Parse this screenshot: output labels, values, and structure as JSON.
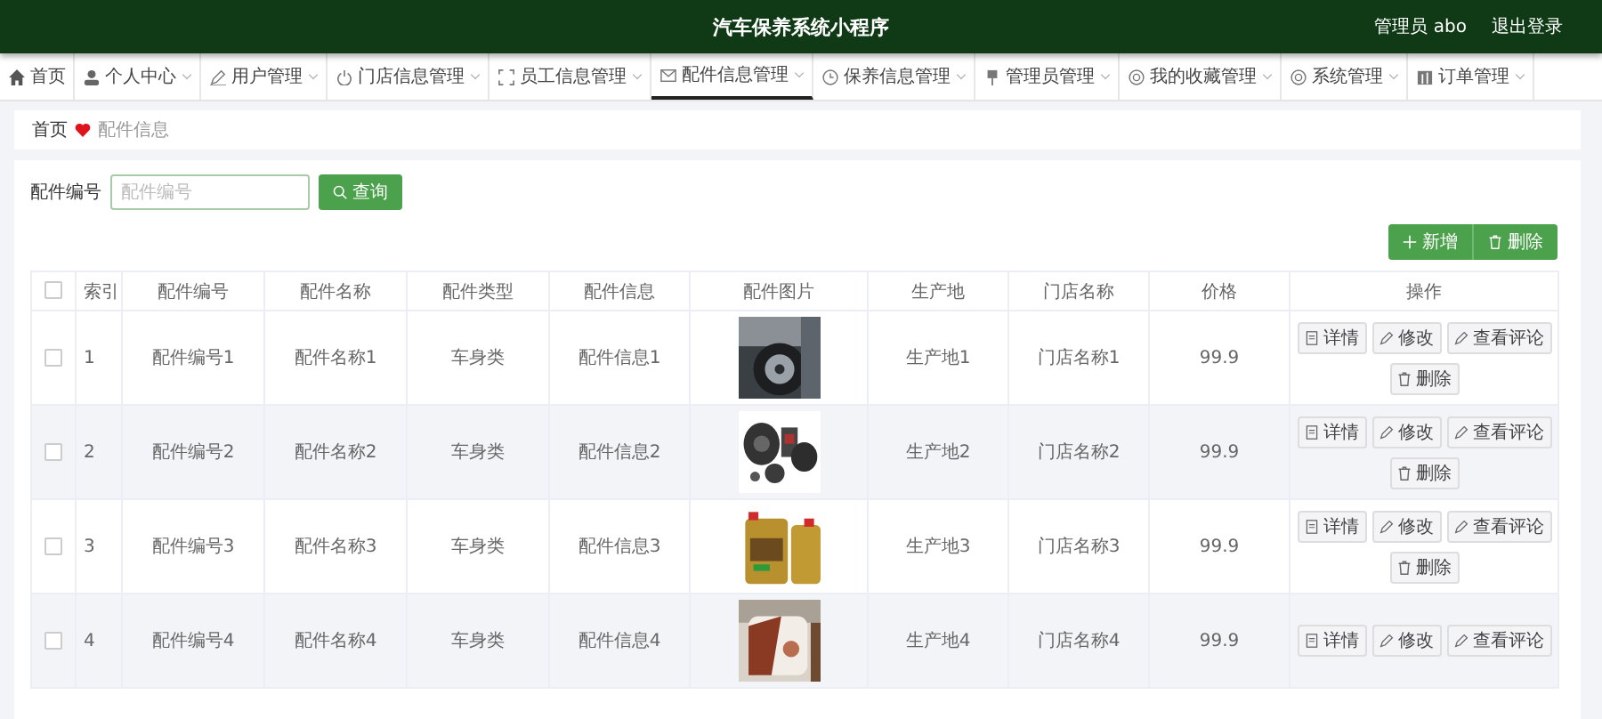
{
  "header": {
    "title": "汽车保养系统小程序",
    "user": "管理员 abo",
    "logout": "退出登录"
  },
  "nav": [
    {
      "label": "首页",
      "dropdown": false,
      "selected": false
    },
    {
      "label": "个人中心",
      "dropdown": true,
      "selected": false
    },
    {
      "label": "用户管理",
      "dropdown": true,
      "selected": false
    },
    {
      "label": "门店信息管理",
      "dropdown": true,
      "selected": false
    },
    {
      "label": "员工信息管理",
      "dropdown": true,
      "selected": false
    },
    {
      "label": "配件信息管理",
      "dropdown": true,
      "selected": true
    },
    {
      "label": "保养信息管理",
      "dropdown": true,
      "selected": false
    },
    {
      "label": "管理员管理",
      "dropdown": true,
      "selected": false
    },
    {
      "label": "我的收藏管理",
      "dropdown": true,
      "selected": false
    },
    {
      "label": "系统管理",
      "dropdown": true,
      "selected": false
    },
    {
      "label": "订单管理",
      "dropdown": true,
      "selected": false
    }
  ],
  "breadcrumb": [
    "首页",
    "配件信息"
  ],
  "search": {
    "label": "配件编号",
    "placeholder": "配件编号",
    "button": "查询"
  },
  "toolbar": [
    "新增",
    "删除"
  ],
  "table": {
    "columns": [
      "索引",
      "配件编号",
      "配件名称",
      "配件类型",
      "配件信息",
      "配件图片",
      "生产地",
      "门店名称",
      "价格",
      "操作"
    ],
    "select_all": false,
    "rows": [
      {
        "checked": false,
        "cells": [
          "1",
          "配件编号1",
          "配件名称1",
          "车身类",
          "配件信息1"
        ],
        "tail": [
          "生产地1",
          "门店名称1",
          "99.9"
        ],
        "actions": [
          "详情",
          "修改",
          "查看评论",
          "删除"
        ]
      },
      {
        "checked": false,
        "cells": [
          "2",
          "配件编号2",
          "配件名称2",
          "车身类",
          "配件信息2"
        ],
        "tail": [
          "生产地2",
          "门店名称2",
          "99.9"
        ],
        "actions": [
          "详情",
          "修改",
          "查看评论",
          "删除"
        ]
      },
      {
        "checked": false,
        "cells": [
          "3",
          "配件编号3",
          "配件名称3",
          "车身类",
          "配件信息3"
        ],
        "tail": [
          "生产地3",
          "门店名称3",
          "99.9"
        ],
        "actions": [
          "详情",
          "修改",
          "查看评论",
          "删除"
        ]
      },
      {
        "checked": false,
        "cells": [
          "4",
          "配件编号4",
          "配件名称4",
          "车身类",
          "配件信息4"
        ],
        "tail": [
          "生产地4",
          "门店名称4",
          "99.9"
        ],
        "actions": [
          "详情",
          "修改",
          "查看评论"
        ]
      }
    ]
  }
}
